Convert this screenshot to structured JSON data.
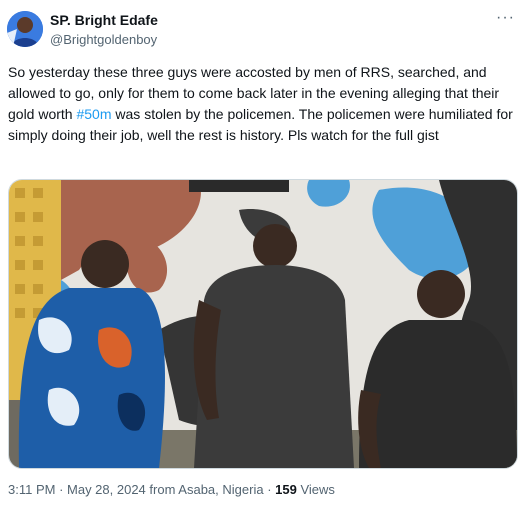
{
  "author": {
    "display_name": "SP. Bright Edafe",
    "handle": "@Brightgoldenboy"
  },
  "menu_icon": "more-horizontal-icon",
  "tweet": {
    "text_before": "So yesterday these three guys were accosted by men of RRS, searched, and allowed to go, only for them to come back later in the evening alleging that their gold worth ",
    "hashtag": "#50m",
    "text_after": " was stolen by the policemen. The policemen were humiliated for simply doing their job, well the rest is history. Pls watch for the full gist"
  },
  "meta": {
    "time": "3:11 PM",
    "sep1": " · ",
    "date": "May 28, 2024",
    "location": " from Asaba, Nigeria",
    "sep2": " · ",
    "views_count": "159",
    "views_label": " Views"
  }
}
